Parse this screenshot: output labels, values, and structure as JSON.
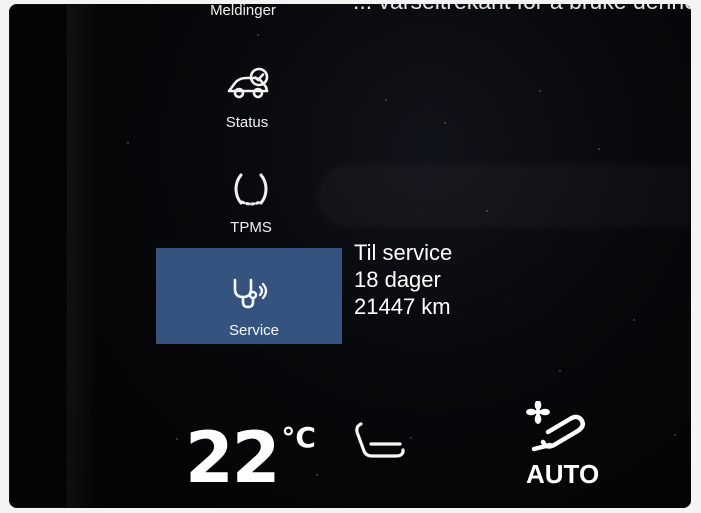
{
  "screen": {
    "top_cutoff_text": "... varseltrekant for å bruke denne tje"
  },
  "sidebar": {
    "items": [
      {
        "label": "Meldinger",
        "icon": "messages-icon"
      },
      {
        "label": "Status",
        "icon": "car-status-icon"
      },
      {
        "label": "TPMS",
        "icon": "tpms-icon"
      },
      {
        "label": "Service",
        "icon": "service-icon",
        "selected": true
      }
    ]
  },
  "service_info": {
    "line1": "Til service",
    "line2": "18 dager",
    "line3": "21447 km"
  },
  "climate": {
    "temperature": "22",
    "unit": "°C",
    "auto_label": "AUTO"
  },
  "colors": {
    "selected_background": "#34537f",
    "text_primary": "#ffffff",
    "screen_background": "#050505"
  }
}
